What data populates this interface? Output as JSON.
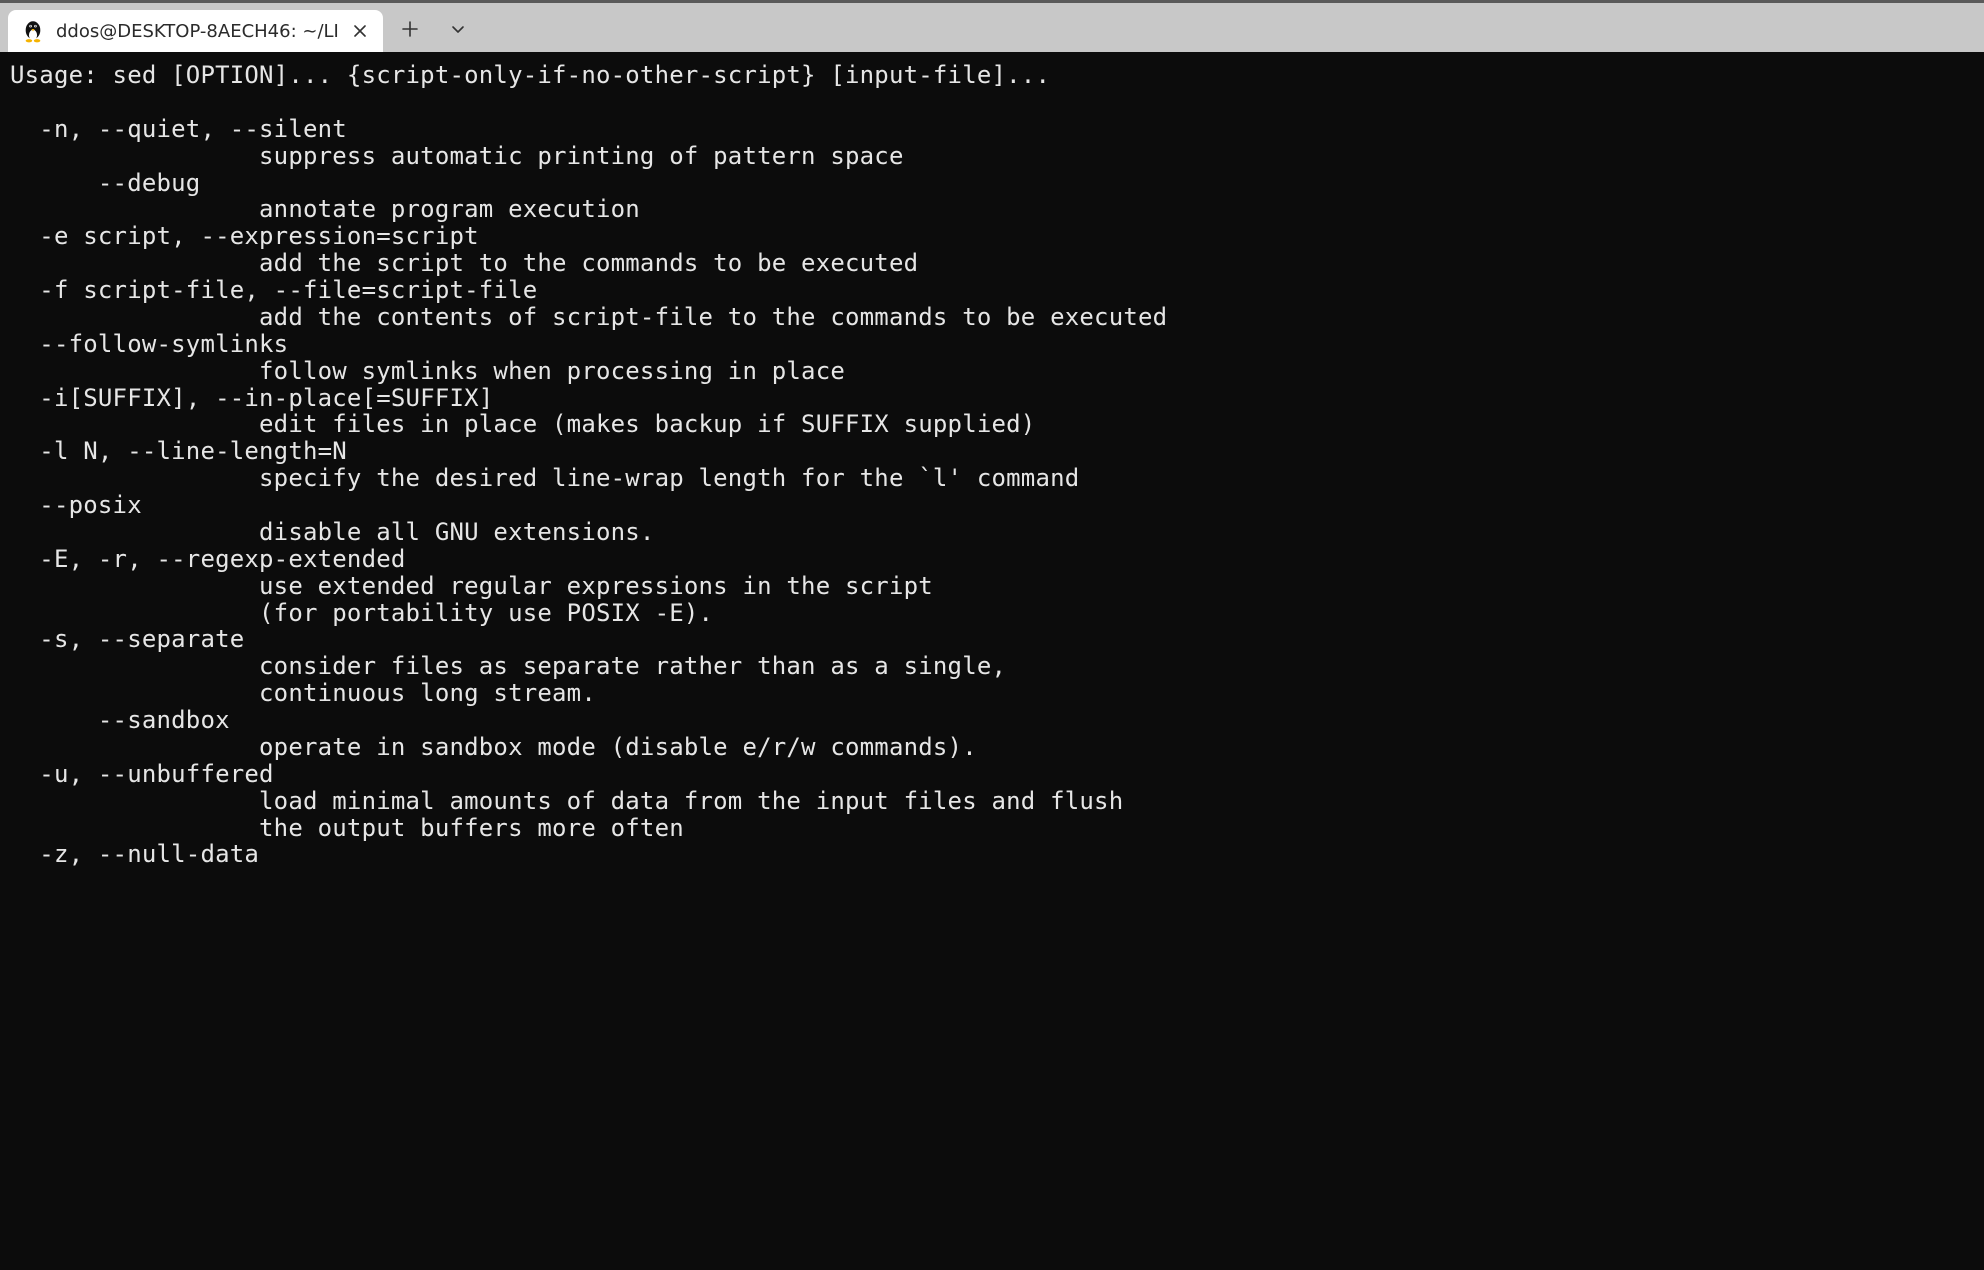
{
  "tabbar": {
    "active_tab_title": "ddos@DESKTOP-8AECH46: ~/LI",
    "icons": {
      "tux": "tux-icon",
      "close": "close-icon",
      "new_tab": "plus-icon",
      "tab_dropdown": "chevron-down-icon"
    }
  },
  "terminal": {
    "content": "Usage: sed [OPTION]... {script-only-if-no-other-script} [input-file]...\n\n  -n, --quiet, --silent\n                 suppress automatic printing of pattern space\n      --debug\n                 annotate program execution\n  -e script, --expression=script\n                 add the script to the commands to be executed\n  -f script-file, --file=script-file\n                 add the contents of script-file to the commands to be executed\n  --follow-symlinks\n                 follow symlinks when processing in place\n  -i[SUFFIX], --in-place[=SUFFIX]\n                 edit files in place (makes backup if SUFFIX supplied)\n  -l N, --line-length=N\n                 specify the desired line-wrap length for the `l' command\n  --posix\n                 disable all GNU extensions.\n  -E, -r, --regexp-extended\n                 use extended regular expressions in the script\n                 (for portability use POSIX -E).\n  -s, --separate\n                 consider files as separate rather than as a single,\n                 continuous long stream.\n      --sandbox\n                 operate in sandbox mode (disable e/r/w commands).\n  -u, --unbuffered\n                 load minimal amounts of data from the input files and flush\n                 the output buffers more often\n  -z, --null-data"
  }
}
